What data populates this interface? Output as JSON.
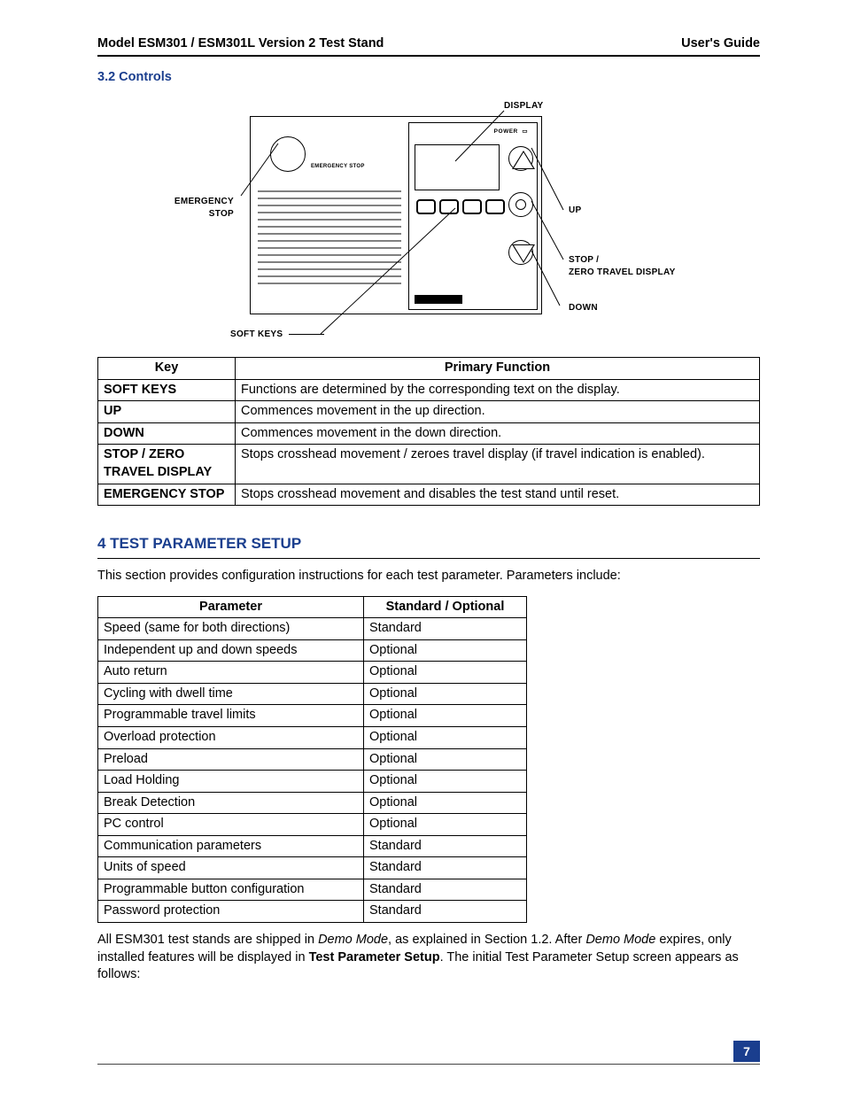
{
  "header": {
    "left": "Model ESM301 / ESM301L Version 2 Test Stand",
    "right": "User's Guide"
  },
  "section32": {
    "title": "3.2 Controls"
  },
  "diagram": {
    "labels": {
      "display": "DISPLAY",
      "emergency_stop": "EMERGENCY\nSTOP",
      "up": "UP",
      "stop_zero": "STOP /\nZERO TRAVEL DISPLAY",
      "down": "DOWN",
      "soft_keys": "SOFT KEYS",
      "power": "POWER",
      "panel_estop": "EMERGENCY STOP"
    }
  },
  "controlsTable": {
    "headers": [
      "Key",
      "Primary Function"
    ],
    "rows": [
      [
        "SOFT KEYS",
        "Functions are determined by the corresponding text on the display."
      ],
      [
        "UP",
        "Commences movement in the up direction."
      ],
      [
        "DOWN",
        "Commences movement in the down direction."
      ],
      [
        "STOP / ZERO TRAVEL DISPLAY",
        "Stops crosshead movement / zeroes travel display (if travel indication is enabled)."
      ],
      [
        "EMERGENCY STOP",
        "Stops crosshead movement and disables the test stand until reset."
      ]
    ]
  },
  "section4": {
    "title": "4  TEST PARAMETER SETUP",
    "intro": "This section provides configuration instructions for each test parameter. Parameters include:"
  },
  "paramsTable": {
    "headers": [
      "Parameter",
      "Standard / Optional"
    ],
    "rows": [
      [
        "Speed (same for both directions)",
        "Standard"
      ],
      [
        "Independent up and down speeds",
        "Optional"
      ],
      [
        "Auto return",
        "Optional"
      ],
      [
        "Cycling with dwell time",
        "Optional"
      ],
      [
        "Programmable travel limits",
        "Optional"
      ],
      [
        "Overload protection",
        "Optional"
      ],
      [
        "Preload",
        "Optional"
      ],
      [
        "Load Holding",
        "Optional"
      ],
      [
        "Break Detection",
        "Optional"
      ],
      [
        "PC control",
        "Optional"
      ],
      [
        "Communication parameters",
        "Standard"
      ],
      [
        "Units of speed",
        "Standard"
      ],
      [
        "Programmable button configuration",
        "Standard"
      ],
      [
        "Password protection",
        "Standard"
      ]
    ]
  },
  "closingPara": {
    "t1": "All ESM301 test stands are shipped in ",
    "demo1": "Demo Mode",
    "t2": ", as explained in Section 1.2. After ",
    "demo2": "Demo Mode",
    "t3": " expires, only installed features will be displayed in ",
    "bold": "Test Parameter Setup",
    "t4": ". The initial Test Parameter Setup screen appears as follows:"
  },
  "pageNumber": "7"
}
